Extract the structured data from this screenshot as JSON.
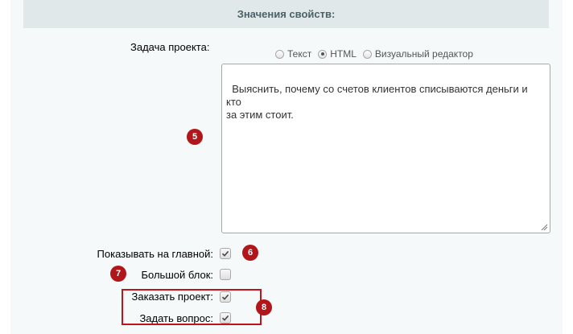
{
  "section": {
    "title": "Значения свойств:"
  },
  "task": {
    "label": "Задача проекта:",
    "format_options": [
      "Текст",
      "HTML",
      "Визуальный редактор"
    ],
    "selected_format": "HTML",
    "text": "Выяснить, почему со счетов клиентов списываются деньги и кто\nза этим стоит."
  },
  "options": {
    "show_on_main": {
      "label": "Показывать на главной:",
      "checked": true
    },
    "big_block": {
      "label": "Большой блок:",
      "checked": false
    },
    "order_project": {
      "label": "Заказать проект:",
      "checked": true
    },
    "ask_question": {
      "label": "Задать вопрос:",
      "checked": true
    }
  },
  "badges": [
    "5",
    "6",
    "7",
    "8"
  ],
  "colors": {
    "header_bg": "#e0e8ea",
    "header_text": "#4b6267",
    "panel_bg": "#f5f9f9",
    "badge": "#b0161a",
    "highlight": "#c0141b"
  }
}
